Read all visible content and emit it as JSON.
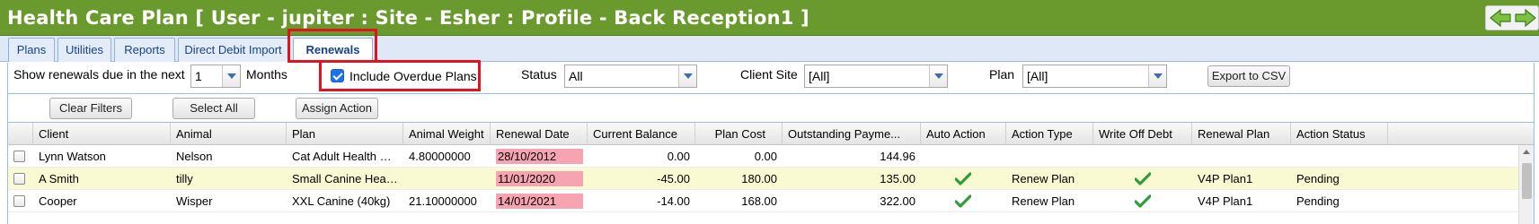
{
  "window": {
    "title": "Health Care Plan [ User - jupiter : Site - Esher : Profile - Back Reception1 ]"
  },
  "tabs": [
    {
      "label": "Plans"
    },
    {
      "label": "Utilities"
    },
    {
      "label": "Reports"
    },
    {
      "label": "Direct Debit Import"
    },
    {
      "label": "Renewals",
      "active": true
    }
  ],
  "filters": {
    "show_label": "Show renewals due in the next",
    "months_value": "1",
    "months_label": "Months",
    "include_overdue_label": "Include Overdue Plans",
    "include_overdue_checked": true,
    "status_label": "Status",
    "status_value": "All",
    "client_site_label": "Client Site",
    "client_site_value": "[All]",
    "plan_label": "Plan",
    "plan_value": "[All]",
    "export_label": "Export to CSV"
  },
  "toolbar": {
    "clear_filters_label": "Clear Filters",
    "select_all_label": "Select All",
    "assign_action_label": "Assign Action"
  },
  "grid": {
    "columns": [
      "Client",
      "Animal",
      "Plan",
      "Animal Weight",
      "Renewal Date",
      "Current Balance",
      "Plan Cost",
      "Outstanding Payme...",
      "Auto Action",
      "Action Type",
      "Write Off Debt",
      "Renewal Plan",
      "Action Status"
    ],
    "rows": [
      {
        "client": "Lynn Watson",
        "animal": "Nelson",
        "plan": "Cat Adult Health Plan",
        "animal_weight": "4.80000000",
        "renewal_date": "28/10/2012",
        "current_balance": "0.00",
        "plan_cost": "0.00",
        "outstanding": "144.96",
        "auto_action": false,
        "action_type": "",
        "write_off_debt": false,
        "renewal_plan": "",
        "action_status": ""
      },
      {
        "client": "A Smith",
        "animal": "tilly",
        "plan": "Small Canine Health Plan",
        "animal_weight": "",
        "renewal_date": "11/01/2020",
        "current_balance": "-45.00",
        "plan_cost": "180.00",
        "outstanding": "135.00",
        "auto_action": true,
        "action_type": "Renew Plan",
        "write_off_debt": true,
        "renewal_plan": "V4P Plan1",
        "action_status": "Pending"
      },
      {
        "client": "Cooper",
        "animal": "Wisper",
        "plan": "XXL Canine (40kg)",
        "animal_weight": "21.10000000",
        "renewal_date": "14/01/2021",
        "current_balance": "-14.00",
        "plan_cost": "168.00",
        "outstanding": "322.00",
        "auto_action": true,
        "action_type": "Renew Plan",
        "write_off_debt": true,
        "renewal_plan": "V4P Plan1",
        "action_status": "Pending"
      }
    ]
  },
  "colors": {
    "titlebar": "#6a9a2e",
    "highlight": "#e0141e",
    "renewal_date_bg": "#f7a4b2",
    "selected_row_bg": "#fafad2",
    "tick": "#2e9e3a"
  }
}
